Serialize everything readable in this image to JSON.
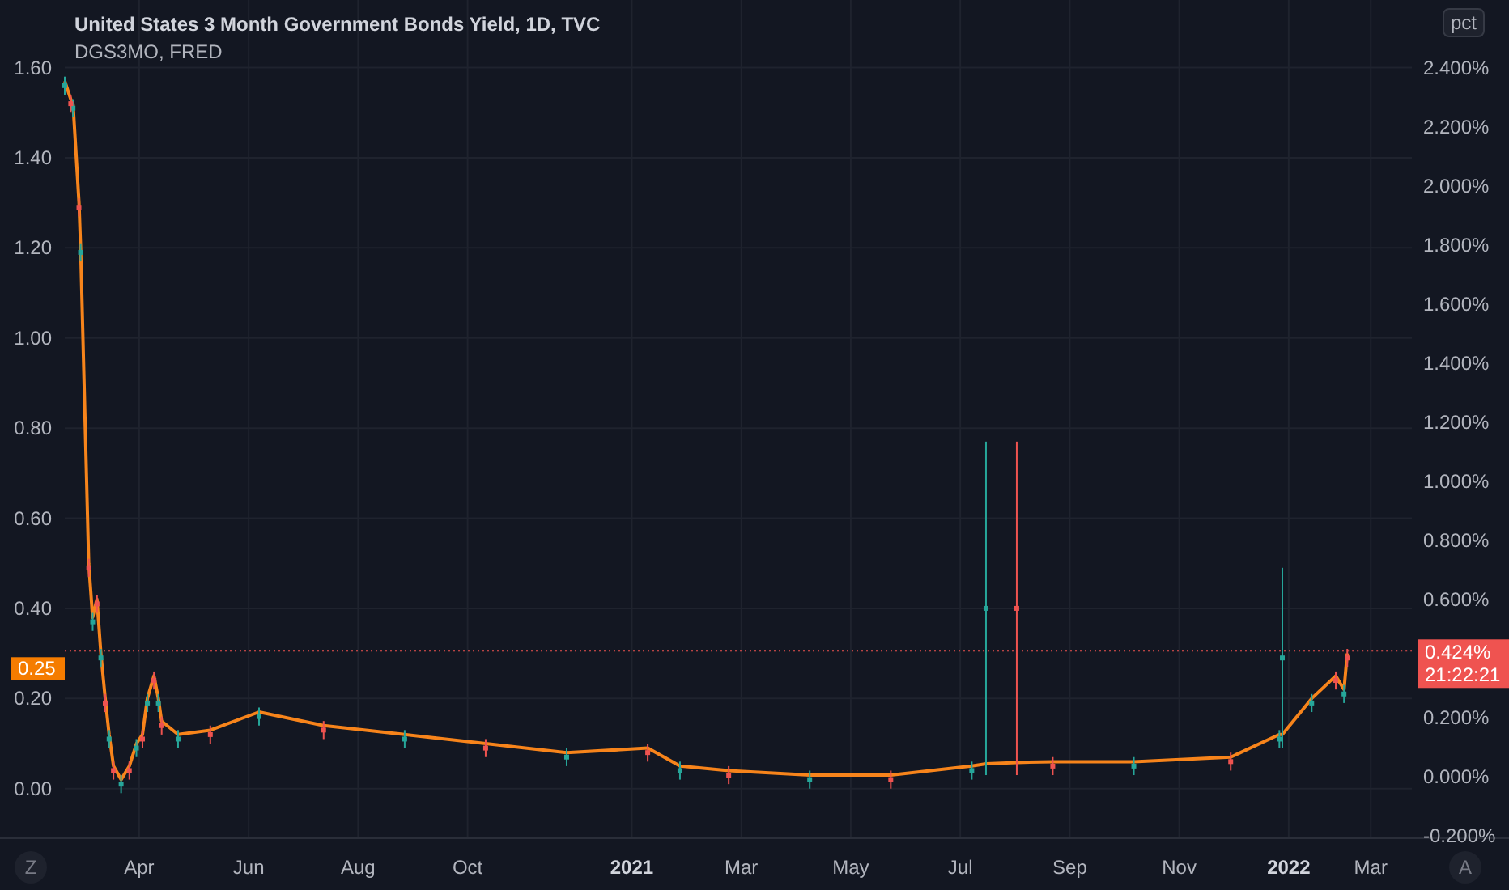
{
  "legend": {
    "title": "United States 3 Month Government Bonds Yield, 1D, TVC",
    "subtitle": "DGS3MO, FRED"
  },
  "unit_badge": "pct",
  "left_price_label": "0.25",
  "right_price_label": {
    "value": "0.424%",
    "time": "21:22:21"
  },
  "right_axis_ticks": [
    "2.400%",
    "2.200%",
    "2.000%",
    "1.800%",
    "1.600%",
    "1.400%",
    "1.200%",
    "1.000%",
    "0.800%",
    "0.600%",
    "0.200%",
    "0.000%",
    "-0.200%"
  ],
  "corner_buttons": [
    "Z",
    "A"
  ],
  "chart_data": {
    "type": "line",
    "xlim": [
      2020.0381,
      2022.3354
    ],
    "ylim": [
      -0.11,
      1.75
    ],
    "grid": true,
    "xticks": [
      {
        "value": 2020.25,
        "label": "Apr"
      },
      {
        "value": 2020.4167,
        "label": "Jun"
      },
      {
        "value": 2020.5833,
        "label": "Aug"
      },
      {
        "value": 2020.75,
        "label": "Oct"
      },
      {
        "value": 2021,
        "label": "2021"
      },
      {
        "value": 2021.1667,
        "label": "Mar"
      },
      {
        "value": 2021.3333,
        "label": "May"
      },
      {
        "value": 2021.5,
        "label": "Jul"
      },
      {
        "value": 2021.6667,
        "label": "Sep"
      },
      {
        "value": 2021.8333,
        "label": "Nov"
      },
      {
        "value": 2022,
        "label": "2022"
      },
      {
        "value": 2022.125,
        "label": "Mar"
      }
    ],
    "yticks": [
      {
        "value": 0,
        "label": "0.00"
      },
      {
        "value": 0.2,
        "label": "0.20"
      },
      {
        "value": 0.4,
        "label": "0.40"
      },
      {
        "value": 0.6,
        "label": "0.60"
      },
      {
        "value": 0.8,
        "label": "0.80"
      },
      {
        "value": 1.0,
        "label": "1.00"
      },
      {
        "value": 1.2,
        "label": "1.20"
      },
      {
        "value": 1.4,
        "label": "1.40"
      },
      {
        "value": 1.6,
        "label": "1.60"
      }
    ],
    "x": [
      2020.1367,
      2020.1458,
      2020.1492,
      2020.1583,
      2020.1608,
      2020.1733,
      2020.1792,
      2020.1858,
      2020.1917,
      2020.1983,
      2020.2042,
      2020.2108,
      2020.2225,
      2020.235,
      2020.2458,
      2020.255,
      2020.2625,
      2020.2725,
      2020.2792,
      2020.2842,
      2020.3092,
      2020.3583,
      2020.4325,
      2020.5308,
      2020.6542,
      2020.7775,
      2020.9008,
      2021.0242,
      2021.0733,
      2021.1475,
      2021.2708,
      2021.3942,
      2021.5175,
      2021.5392,
      2021.586,
      2021.6408,
      2021.7642,
      2021.9117,
      2021.9858,
      2021.9903,
      2022.035,
      2022.0717,
      2022.0842,
      2022.0892
    ],
    "series": [
      {
        "color": "#f7841b",
        "values": [
          1.57,
          1.53,
          1.52,
          1.3,
          1.2,
          0.5,
          0.38,
          0.42,
          0.3,
          0.2,
          0.12,
          0.05,
          0.02,
          0.05,
          0.1,
          0.12,
          0.2,
          0.25,
          0.2,
          0.15,
          0.12,
          0.13,
          0.17,
          0.14,
          0.12,
          0.1,
          0.08,
          0.09,
          0.05,
          0.04,
          0.03,
          0.03,
          0.05,
          0.055,
          0.058,
          0.06,
          0.06,
          0.07,
          0.12,
          0.12,
          0.2,
          0.25,
          0.22,
          0.3
        ]
      },
      {
        "type": "line",
        "line_style": "dotted",
        "color": "#ef5350",
        "values": [
          0.306,
          0.306,
          0.306,
          0.306,
          0.306,
          0.306,
          0.306,
          0.306,
          0.306,
          0.306,
          0.306,
          0.306,
          0.306,
          0.306,
          0.306,
          0.306,
          0.306,
          0.306,
          0.306,
          0.306,
          0.306,
          0.306,
          0.306,
          0.306,
          0.306,
          0.306,
          0.306,
          0.306,
          0.306,
          0.306,
          0.306,
          0.306,
          0.306,
          0.306,
          0.306,
          0.306,
          0.306,
          0.306,
          0.306,
          0.306,
          0.306,
          0.306,
          0.306,
          0.306
        ]
      },
      {
        "type": "scatter",
        "color": "#26a69a",
        "values": [
          1.56,
          null,
          1.51,
          null,
          1.19,
          null,
          0.37,
          null,
          0.29,
          null,
          0.11,
          null,
          0.01,
          null,
          0.09,
          null,
          0.19,
          null,
          0.19,
          null,
          0.11,
          null,
          0.16,
          null,
          0.11,
          null,
          0.07,
          null,
          0.04,
          null,
          0.02,
          null,
          0.04,
          0.4,
          null,
          null,
          0.05,
          null,
          0.11,
          0.29,
          0.19,
          null,
          0.21,
          null
        ],
        "errors": [
          0.02,
          null,
          0.02,
          null,
          0.02,
          null,
          0.02,
          null,
          0.02,
          null,
          0.02,
          null,
          0.02,
          null,
          0.02,
          null,
          0.02,
          null,
          0.02,
          null,
          0.02,
          null,
          0.02,
          null,
          0.02,
          null,
          0.02,
          null,
          0.02,
          null,
          0.02,
          null,
          0.02,
          0.37,
          null,
          null,
          0.02,
          null,
          0.02,
          0.2,
          0.02,
          null,
          0.02,
          null
        ]
      },
      {
        "type": "scatter",
        "color": "#ef5350",
        "values": [
          null,
          1.52,
          null,
          1.29,
          null,
          0.49,
          null,
          0.41,
          null,
          0.19,
          null,
          0.04,
          null,
          0.04,
          null,
          0.11,
          null,
          0.24,
          null,
          0.14,
          null,
          0.12,
          null,
          0.13,
          null,
          0.09,
          null,
          0.08,
          null,
          0.03,
          null,
          0.02,
          null,
          null,
          0.4,
          0.05,
          null,
          0.06,
          null,
          null,
          null,
          0.24,
          null,
          0.29
        ],
        "errors": [
          null,
          0.02,
          null,
          0.02,
          null,
          0.02,
          null,
          0.02,
          null,
          0.02,
          null,
          0.02,
          null,
          0.02,
          null,
          0.02,
          null,
          0.02,
          null,
          0.02,
          null,
          0.02,
          null,
          0.02,
          null,
          0.02,
          null,
          0.02,
          null,
          0.02,
          null,
          0.02,
          null,
          null,
          0.37,
          0.02,
          null,
          0.02,
          null,
          null,
          null,
          0.02,
          null,
          0.02
        ]
      }
    ]
  }
}
